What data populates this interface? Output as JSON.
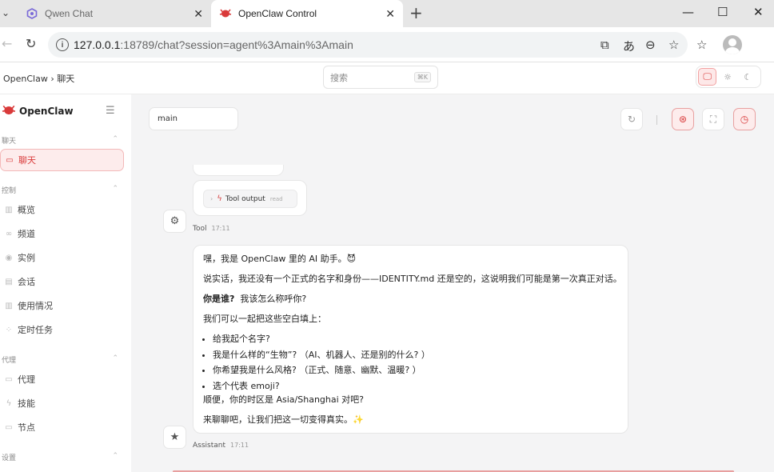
{
  "browser": {
    "tabs": [
      {
        "title": "Qwen Chat",
        "active": false
      },
      {
        "title": "OpenClaw Control",
        "active": true
      }
    ],
    "new_tab": "+",
    "url_host": "127.0.0.1",
    "url_path": ":18789/chat?session=agent%3Amain%3Amain",
    "window_controls": {
      "minimize": "—",
      "maximize": "☐",
      "close": "✕"
    }
  },
  "header": {
    "breadcrumb": "OpenClaw › 聊天",
    "search_placeholder": "搜索",
    "search_shortcut": "⌘K"
  },
  "sidebar": {
    "app_name": "OpenClaw",
    "sections": [
      {
        "label": "聊天",
        "items": [
          {
            "label": "聊天",
            "icon": "chat-icon",
            "active": true
          }
        ]
      },
      {
        "label": "控制",
        "items": [
          {
            "label": "概览",
            "icon": "bar-chart-icon"
          },
          {
            "label": "频道",
            "icon": "link-icon"
          },
          {
            "label": "实例",
            "icon": "radio-icon"
          },
          {
            "label": "会话",
            "icon": "file-icon"
          },
          {
            "label": "使用情况",
            "icon": "bar-chart-icon"
          },
          {
            "label": "定时任务",
            "icon": "loader-icon"
          }
        ]
      },
      {
        "label": "代理",
        "items": [
          {
            "label": "代理",
            "icon": "folder-icon"
          },
          {
            "label": "技能",
            "icon": "bolt-icon"
          },
          {
            "label": "节点",
            "icon": "monitor-icon"
          }
        ]
      },
      {
        "label": "设置",
        "items": []
      }
    ]
  },
  "chat": {
    "session": "main",
    "tool_output": {
      "label": "Tool output",
      "tag": "read"
    },
    "tool_meta": {
      "role": "Tool",
      "time": "17:11"
    },
    "assistant_meta": {
      "role": "Assistant",
      "time": "17:11"
    },
    "message": {
      "greeting": "嘿，我是 OpenClaw 里的 AI 助手。😈",
      "line1": "说实话，我还没有一个正式的名字和身份——IDENTITY.md 还是空的，这说明我们可能是第一次真正对话。",
      "bold_question": "你是谁?",
      "question_rest": "我该怎么称呼你?",
      "fill_intro": "我们可以一起把这些空白填上：",
      "bullets": [
        "给我起个名字?",
        "我是什么样的“生物”? （AI、机器人、还是别的什么? ）",
        "你希望我是什么风格? （正式、随意、幽默、温暖? ）",
        "选个代表 emoji?"
      ],
      "timezone": "顺便，你的时区是 Asia/Shanghai 对吧?",
      "closing": "来聊聊吧，让我们把这一切变得真实。✨"
    }
  },
  "colors": {
    "accent": "#d93a3a",
    "accent_bg": "#fdecec"
  }
}
